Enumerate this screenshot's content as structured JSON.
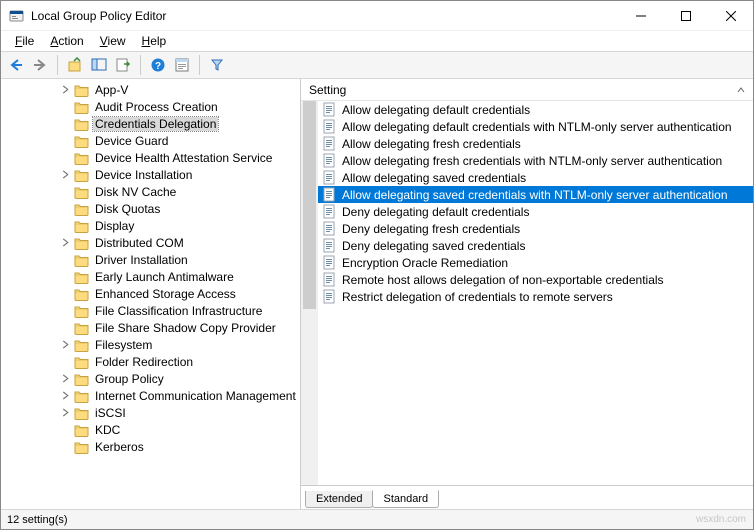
{
  "window": {
    "title": "Local Group Policy Editor"
  },
  "menu": {
    "file": "File",
    "action": "Action",
    "view": "View",
    "help": "Help"
  },
  "tree": {
    "items": [
      {
        "label": "App-V",
        "expandable": true
      },
      {
        "label": "Audit Process Creation",
        "expandable": false
      },
      {
        "label": "Credentials Delegation",
        "expandable": false,
        "selected": true
      },
      {
        "label": "Device Guard",
        "expandable": false
      },
      {
        "label": "Device Health Attestation Service",
        "expandable": false
      },
      {
        "label": "Device Installation",
        "expandable": true
      },
      {
        "label": "Disk NV Cache",
        "expandable": false
      },
      {
        "label": "Disk Quotas",
        "expandable": false
      },
      {
        "label": "Display",
        "expandable": false
      },
      {
        "label": "Distributed COM",
        "expandable": true
      },
      {
        "label": "Driver Installation",
        "expandable": false
      },
      {
        "label": "Early Launch Antimalware",
        "expandable": false
      },
      {
        "label": "Enhanced Storage Access",
        "expandable": false
      },
      {
        "label": "File Classification Infrastructure",
        "expandable": false
      },
      {
        "label": "File Share Shadow Copy Provider",
        "expandable": false
      },
      {
        "label": "Filesystem",
        "expandable": true
      },
      {
        "label": "Folder Redirection",
        "expandable": false
      },
      {
        "label": "Group Policy",
        "expandable": true
      },
      {
        "label": "Internet Communication Management",
        "expandable": true
      },
      {
        "label": "iSCSI",
        "expandable": true
      },
      {
        "label": "KDC",
        "expandable": false
      },
      {
        "label": "Kerberos",
        "expandable": false
      }
    ]
  },
  "settings": {
    "header": "Setting",
    "items": [
      {
        "label": "Allow delegating default credentials"
      },
      {
        "label": "Allow delegating default credentials with NTLM-only server authentication"
      },
      {
        "label": "Allow delegating fresh credentials"
      },
      {
        "label": "Allow delegating fresh credentials with NTLM-only server authentication"
      },
      {
        "label": "Allow delegating saved credentials"
      },
      {
        "label": "Allow delegating saved credentials with NTLM-only server authentication",
        "selected": true
      },
      {
        "label": "Deny delegating default credentials"
      },
      {
        "label": "Deny delegating fresh credentials"
      },
      {
        "label": "Deny delegating saved credentials"
      },
      {
        "label": "Encryption Oracle Remediation"
      },
      {
        "label": "Remote host allows delegation of non-exportable credentials"
      },
      {
        "label": "Restrict delegation of credentials to remote servers"
      }
    ]
  },
  "tabs": {
    "extended": "Extended",
    "standard": "Standard"
  },
  "status": {
    "text": "12 setting(s)"
  },
  "watermark": "wsxdn.com"
}
